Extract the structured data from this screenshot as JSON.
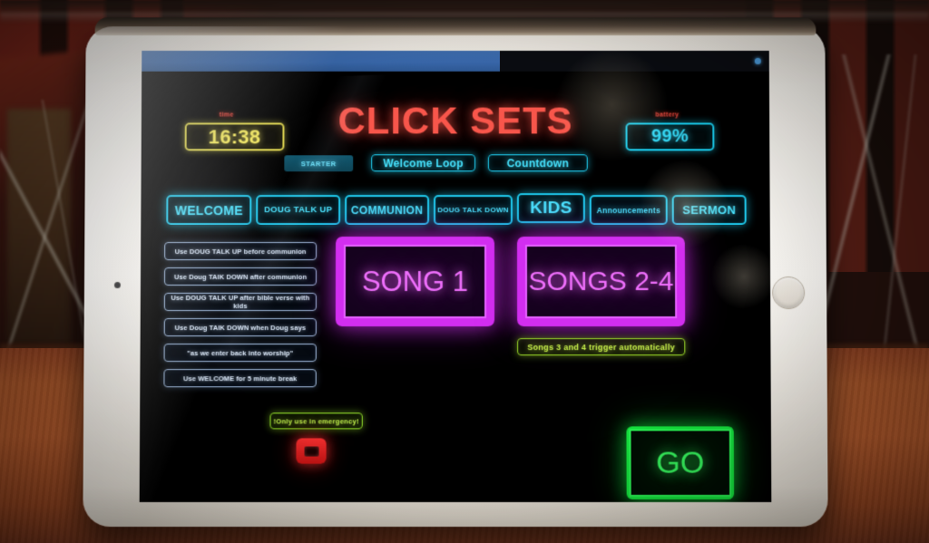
{
  "app": {
    "title": "CLICK SETS"
  },
  "status": {
    "time_label": "time",
    "time_value": "16:38",
    "battery_label": "battery",
    "battery_value": "99%"
  },
  "modes": {
    "starter_label": "STARTER",
    "welcome_loop_label": "Welcome Loop",
    "countdown_label": "Countdown"
  },
  "cues": [
    {
      "label": "WELCOME"
    },
    {
      "label": "DOUG TALK UP"
    },
    {
      "label": "COMMUNION"
    },
    {
      "label": "DOUG TALK DOWN"
    },
    {
      "label": "KIDS"
    },
    {
      "label": "Announcements"
    },
    {
      "label": "SERMON"
    }
  ],
  "notes": [
    {
      "text": "Use DOUG TALK UP before communion"
    },
    {
      "text": "Use Doug TAlK DOWN after communion"
    },
    {
      "text": "Use DOUG TALK UP after bible verse with kids"
    },
    {
      "text": "Use Doug TAlK DOWN when Doug says"
    },
    {
      "text": "\"as we enter back into worship\""
    },
    {
      "text": "Use WELCOME for 5 minute break"
    }
  ],
  "songs": {
    "song1_label": "SONG 1",
    "song2_label": "SONGS 2-4",
    "auto_note": "Songs 3 and 4 trigger automatically"
  },
  "emergency": {
    "warning": "!Only use in emergency!",
    "stop_icon": "stop-square-icon"
  },
  "transport": {
    "go_label": "GO"
  },
  "colors": {
    "cyan": "#20cdef",
    "magenta": "#d22ef0",
    "green": "#15e03d",
    "red": "#f8564b",
    "yellow": "#d8cf4a",
    "lime": "#9bd92a",
    "progress_blue": "#3f6eb0"
  }
}
